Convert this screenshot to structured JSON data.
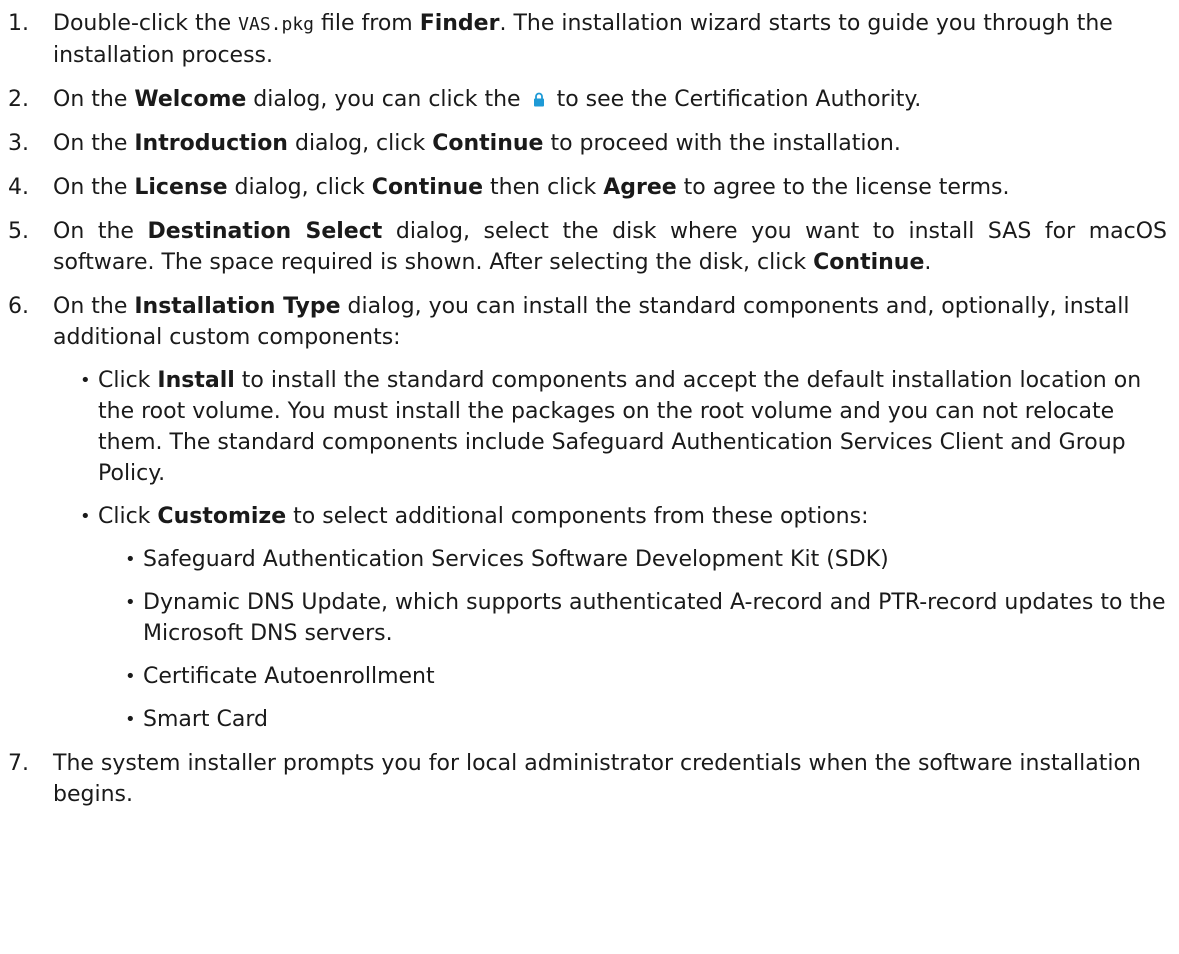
{
  "lock_icon": {
    "name": "lock-icon",
    "color": "#1e9ad6"
  },
  "steps": [
    {
      "number": "1.",
      "t0": "Double-click the ",
      "code": "VAS.pkg",
      "t1": " file from ",
      "b1": "Finder",
      "t2": ". The installation wizard starts to guide you through the installation process."
    },
    {
      "number": "2.",
      "t0": "On the ",
      "b1": "Welcome",
      "t1": " dialog, you can click the ",
      "t2": " to see the Certification Authority."
    },
    {
      "number": "3.",
      "t0": "On the ",
      "b1": "Introduction",
      "t1": " dialog, click ",
      "b2": "Continue",
      "t2": " to proceed with the installation."
    },
    {
      "number": "4.",
      "t0": "On the ",
      "b1": "License",
      "t1": " dialog, click ",
      "b2": "Continue",
      "t2": " then click ",
      "b3": "Agree",
      "t3": " to agree to the license terms."
    },
    {
      "number": "5.",
      "t0": "On the ",
      "b1": "Destination Select",
      "t1": " dialog, select the disk where you want to install SAS for macOS software. The space required is shown. After selecting the disk, click ",
      "b2": "Continue",
      "t2": "."
    },
    {
      "number": "6.",
      "t0": "On the ",
      "b1": "Installation Type",
      "t1": " dialog, you can install the standard components and, optionally, install additional custom components:",
      "bullets": [
        {
          "t0": "Click ",
          "b1": "Install",
          "t1": " to install the standard components and accept the default installation location on the root volume. You must install the packages on the root volume and you can not relocate them. The standard components include Safeguard Authentication Services Client and Group Policy."
        },
        {
          "t0": "Click ",
          "b1": "Customize",
          "t1": " to select additional components from these options:",
          "options": [
            "Safeguard Authentication Services Software Development Kit (SDK)",
            "Dynamic DNS Update, which supports authenticated A-record and PTR-record updates to the Microsoft DNS servers.",
            "Certificate Autoenrollment",
            "Smart Card"
          ]
        }
      ]
    },
    {
      "number": "7.",
      "t0": "The system installer prompts you for local administrator credentials when the software installation begins."
    }
  ]
}
